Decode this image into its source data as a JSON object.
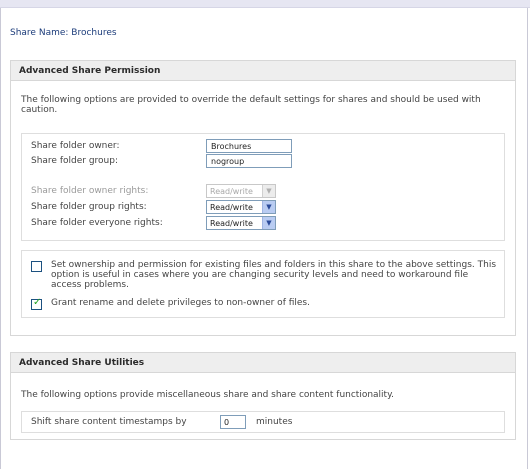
{
  "share": {
    "prefix": "Share Name:",
    "name": "Brochures"
  },
  "permission": {
    "title": "Advanced Share Permission",
    "description": "The following options are provided to override the default settings for shares and should be used with caution.",
    "owner_label": "Share folder owner:",
    "owner_value": "Brochures",
    "group_label": "Share folder group:",
    "group_value": "nogroup",
    "owner_rights_label": "Share folder owner rights:",
    "owner_rights_value": "Read/write",
    "group_rights_label": "Share folder group rights:",
    "group_rights_value": "Read/write",
    "everyone_rights_label": "Share folder everyone rights:",
    "everyone_rights_value": "Read/write",
    "set_ownership_label": "Set ownership and permission for existing files and folders in this share to the above settings. This option is useful in cases where you are changing security levels and need to workaround file access problems.",
    "set_ownership_checked": false,
    "grant_rename_label": "Grant rename and delete privileges to non-owner of files.",
    "grant_rename_checked": true
  },
  "utilities": {
    "title": "Advanced Share Utilities",
    "description": "The following options provide miscellaneous share and share content functionality.",
    "shift_label": "Shift share content timestamps by",
    "shift_value": "0",
    "shift_unit": "minutes"
  },
  "icons": {
    "dropdown": "chevron-down-icon",
    "check": "checkmark-icon"
  },
  "colors": {
    "share_name": "#1c3c7a",
    "checkmark": "#21a121",
    "dropdown_arrow_bg": "#b9ccf2"
  }
}
